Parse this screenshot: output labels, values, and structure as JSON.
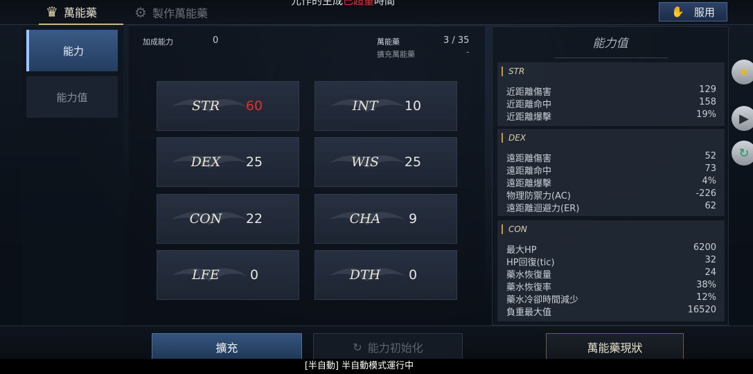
{
  "top_tabs": [
    {
      "label": "萬能藥",
      "icon": "potion-icon"
    },
    {
      "label": "製作萬能藥",
      "icon": "craft-icon"
    }
  ],
  "top_notice": {
    "prefix": "元作的生成",
    "highlight": "已超量",
    "suffix": "時間"
  },
  "use_button": {
    "label": "服用",
    "icon": "hand-potion-icon"
  },
  "side_nav": [
    {
      "label": "能力"
    },
    {
      "label": "能力值"
    }
  ],
  "header": {
    "bonus_label": "加成能力",
    "bonus_value": "0",
    "elixir_label": "萬能藥",
    "elixir_value": "3 / 35",
    "expand_label": "擴充萬能藥",
    "expand_value": "-"
  },
  "stats": [
    {
      "name": "STR",
      "value": "60"
    },
    {
      "name": "INT",
      "value": "10"
    },
    {
      "name": "DEX",
      "value": "25"
    },
    {
      "name": "WIS",
      "value": "25"
    },
    {
      "name": "CON",
      "value": "22"
    },
    {
      "name": "CHA",
      "value": "9"
    },
    {
      "name": "LFE",
      "value": "0"
    },
    {
      "name": "DTH",
      "value": "0"
    }
  ],
  "colors": {
    "highlight_stat": "#e0302a",
    "accent_blue": "#3a5a86",
    "gold": "#c9b98a"
  },
  "right_panel": {
    "title": "能力值",
    "groups": [
      {
        "title": "STR",
        "rows": [
          {
            "label": "近距離傷害",
            "value": "129"
          },
          {
            "label": "近距離命中",
            "value": "158"
          },
          {
            "label": "近距離爆擊",
            "value": "19%"
          }
        ]
      },
      {
        "title": "DEX",
        "rows": [
          {
            "label": "遠距離傷害",
            "value": "52"
          },
          {
            "label": "遠距離命中",
            "value": "73"
          },
          {
            "label": "遠距離爆擊",
            "value": "4%"
          },
          {
            "label": "物理防禦力(AC)",
            "value": "-226"
          },
          {
            "label": "遠距離迴避力(ER)",
            "value": "62"
          }
        ]
      },
      {
        "title": "CON",
        "rows": [
          {
            "label": "最大HP",
            "value": "6200"
          },
          {
            "label": "HP回復(tic)",
            "value": "32"
          },
          {
            "label": "藥水恢復量",
            "value": "24"
          },
          {
            "label": "藥水恢復率",
            "value": "38%"
          },
          {
            "label": "藥水冷卻時間減少",
            "value": "12%"
          },
          {
            "label": "負重最大值",
            "value": "16520"
          }
        ]
      }
    ]
  },
  "edge_icons": [
    "star-icon",
    "play-icon",
    "swirl-icon"
  ],
  "buttons": {
    "expand": "擴充",
    "reset": "能力初始化",
    "status": "萬能藥現狀"
  },
  "status_line": "[半自動] 半自動模式運行中"
}
